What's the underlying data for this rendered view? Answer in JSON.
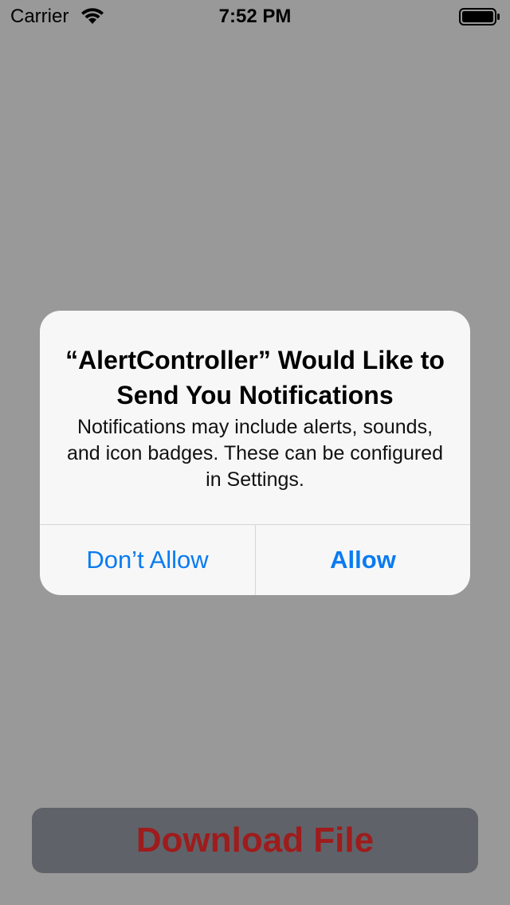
{
  "status_bar": {
    "carrier": "Carrier",
    "time": "7:52 PM",
    "wifi_icon": "wifi-icon",
    "battery_icon": "battery-icon"
  },
  "alert": {
    "title": "“AlertController” Would Like to Send You Notifications",
    "message": "Notifications may include alerts, sounds, and icon badges. These can be configured in Settings.",
    "dont_allow_label": "Don’t Allow",
    "allow_label": "Allow",
    "button_color": "#0a7bf0"
  },
  "download_button": {
    "label": "Download File",
    "text_color": "#9e1c1c",
    "background": "#5f6269"
  },
  "colors": {
    "dimmed_background": "#999999",
    "alert_background": "#f7f7f7"
  }
}
